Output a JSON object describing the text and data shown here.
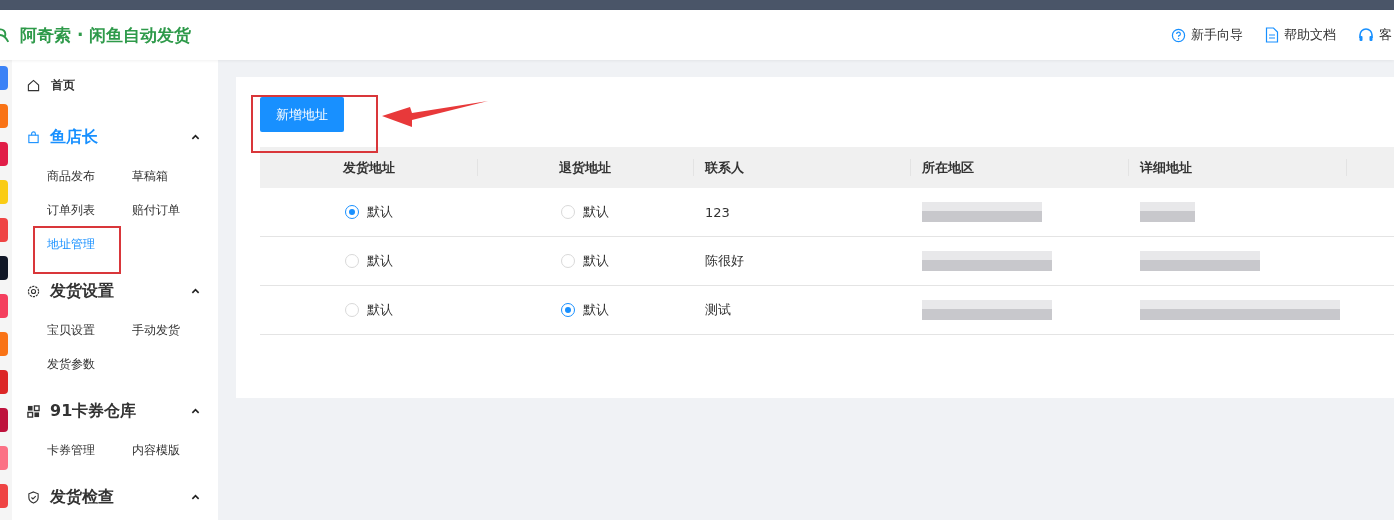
{
  "header": {
    "title": "阿奇索 · 闲鱼自动发货",
    "links": [
      {
        "label": "新手向导"
      },
      {
        "label": "帮助文档"
      },
      {
        "label": "客"
      }
    ]
  },
  "sidebar": {
    "home": {
      "label": "首页"
    },
    "groups": [
      {
        "title": "鱼店长",
        "active": true,
        "expanded": true,
        "items": [
          {
            "label": "商品发布",
            "selected": false
          },
          {
            "label": "草稿箱",
            "selected": false
          },
          {
            "label": "订单列表",
            "selected": false
          },
          {
            "label": "赔付订单",
            "selected": false
          },
          {
            "label": "地址管理",
            "selected": true
          }
        ]
      },
      {
        "title": "发货设置",
        "active": false,
        "expanded": true,
        "items": [
          {
            "label": "宝贝设置",
            "selected": false
          },
          {
            "label": "手动发货",
            "selected": false
          },
          {
            "label": "发货参数",
            "selected": false
          }
        ]
      },
      {
        "title": "91卡券仓库",
        "active": false,
        "expanded": true,
        "items": [
          {
            "label": "卡券管理",
            "selected": false
          },
          {
            "label": "内容模版",
            "selected": false
          }
        ]
      },
      {
        "title": "发货检查",
        "active": false,
        "expanded": true
      }
    ]
  },
  "main": {
    "add_button": "新增地址",
    "table": {
      "columns": [
        "发货地址",
        "退货地址",
        "联系人",
        "所在地区",
        "详细地址"
      ],
      "rows": [
        {
          "ship_default": {
            "label": "默认",
            "selected": true
          },
          "return_default": {
            "label": "默认",
            "selected": false
          },
          "contact": "123"
        },
        {
          "ship_default": {
            "label": "默认",
            "selected": false
          },
          "return_default": {
            "label": "默认",
            "selected": false
          },
          "contact": "陈很好"
        },
        {
          "ship_default": {
            "label": "默认",
            "selected": false
          },
          "return_default": {
            "label": "默认",
            "selected": true
          },
          "contact": "测试"
        }
      ]
    }
  }
}
